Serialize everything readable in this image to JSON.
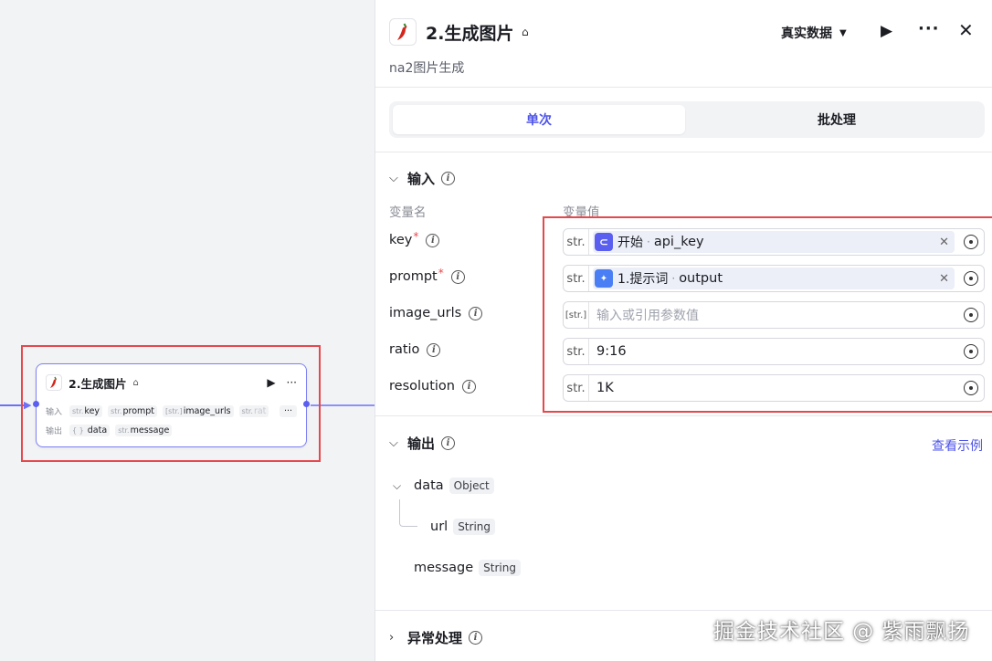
{
  "node": {
    "title": "2.生成图片",
    "input_label": "输入",
    "output_label": "输出",
    "inputs": [
      {
        "type": "str.",
        "name": "key"
      },
      {
        "type": "str.",
        "name": "prompt"
      },
      {
        "type": "[str.]",
        "name": "image_urls"
      },
      {
        "type": "str.",
        "name": "rat"
      }
    ],
    "more": "···",
    "outputs": [
      {
        "type": "{ }",
        "name": "data"
      },
      {
        "type": "str.",
        "name": "message"
      }
    ]
  },
  "panel": {
    "title": "2.生成图片",
    "description": "na2图片生成",
    "data_mode": "真实数据",
    "tabs": {
      "single": "单次",
      "batch": "批处理"
    },
    "input_section": {
      "title": "输入",
      "col_name": "变量名",
      "col_value": "变量值",
      "rows": [
        {
          "name": "key",
          "required": "*",
          "type": "str.",
          "ref_node": "开始",
          "ref_var": "api_key"
        },
        {
          "name": "prompt",
          "required": "*",
          "type": "str.",
          "ref_node": "1.提示词",
          "ref_var": "output"
        },
        {
          "name": "image_urls",
          "type": "[str.]",
          "placeholder": "输入或引用参数值"
        },
        {
          "name": "ratio",
          "type": "str.",
          "value": "9:16"
        },
        {
          "name": "resolution",
          "type": "str.",
          "value": "1K"
        }
      ]
    },
    "output_section": {
      "title": "输出",
      "example_link": "查看示例",
      "fields": [
        {
          "name": "data",
          "type": "Object"
        },
        {
          "name": "url",
          "type": "String"
        },
        {
          "name": "message",
          "type": "String"
        }
      ]
    },
    "error_section": {
      "title": "异常处理"
    }
  },
  "watermark": "掘金技术社区 @ 紫雨飘扬",
  "colors": {
    "accent": "#4d53e8",
    "highlight": "#e5484d",
    "edge": "#6b70f5"
  }
}
